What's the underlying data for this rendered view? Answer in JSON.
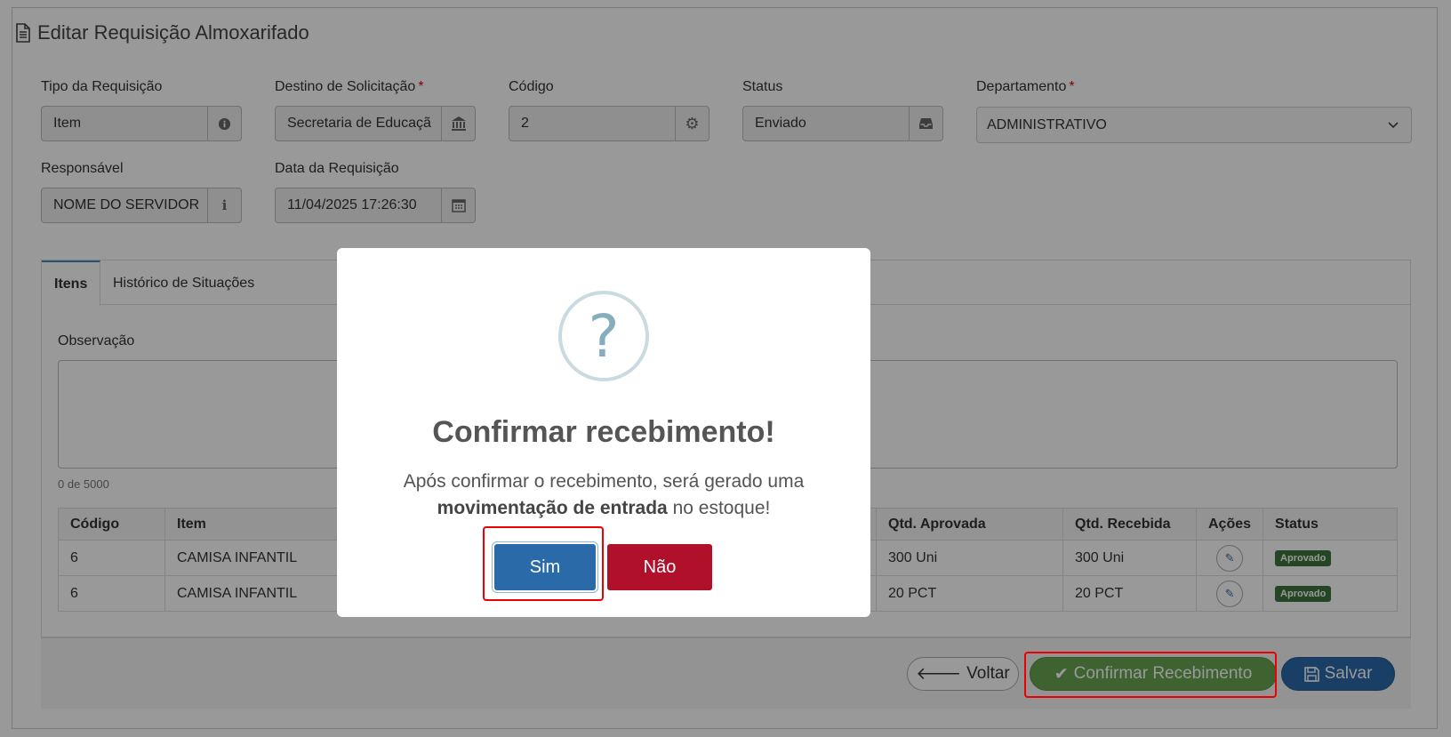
{
  "page": {
    "title": "Editar Requisição Almoxarifado",
    "title_icon": "file-text-icon"
  },
  "form": {
    "tipo": {
      "label": "Tipo da Requisição",
      "value": "Item",
      "icon": "info-circle-icon"
    },
    "destino": {
      "label": "Destino de Solicitação",
      "required_mark": "*",
      "value": "Secretaria de Educaçã",
      "icon": "bank-icon"
    },
    "codigo": {
      "label": "Código",
      "value": "2",
      "icon": "cog-icon"
    },
    "status": {
      "label": "Status",
      "value": "Enviado",
      "icon": "inbox-icon"
    },
    "departamento": {
      "label": "Departamento",
      "required_mark": "*",
      "value": "ADMINISTRATIVO",
      "icon": "chevron-down-icon"
    },
    "responsavel": {
      "label": "Responsável",
      "value": "NOME DO SERVIDOR",
      "icon": "info-icon"
    },
    "data": {
      "label": "Data da Requisição",
      "value": "11/04/2025 17:26:30",
      "icon": "calendar-icon"
    }
  },
  "tabs": [
    {
      "label": "Itens",
      "active": true
    },
    {
      "label": "Histórico de Situações",
      "active": false
    }
  ],
  "observacao": {
    "label": "Observação",
    "value": "",
    "counter": "0 de 5000"
  },
  "table": {
    "headers": [
      "Código",
      "Item",
      "Qtd. Aprovada",
      "Qtd. Recebida",
      "Ações",
      "Status"
    ],
    "rows": [
      {
        "codigo": "6",
        "item": "CAMISA INFANTIL",
        "qtd_aprovada": "300 Uni",
        "qtd_recebida": "300 Uni",
        "status": "Aprovado"
      },
      {
        "codigo": "6",
        "item": "CAMISA INFANTIL",
        "qtd_aprovada": "20 PCT",
        "qtd_recebida": "20 PCT",
        "status": "Aprovado"
      }
    ]
  },
  "footer": {
    "voltar_label": "Voltar",
    "confirmar_label": "Confirmar Recebimento",
    "salvar_label": "Salvar"
  },
  "modal": {
    "icon": "?",
    "title": "Confirmar recebimento!",
    "text_before": "Após confirmar o recebimento, será gerado uma",
    "text_bold": "movimentação de entrada",
    "text_after": "no estoque!",
    "confirm_label": "Sim",
    "cancel_label": "Não"
  },
  "colors": {
    "confirm_green": "#6aa352",
    "primary_blue": "#2a6aa8",
    "danger_red": "#b0102a",
    "highlight_red": "#e00000"
  }
}
